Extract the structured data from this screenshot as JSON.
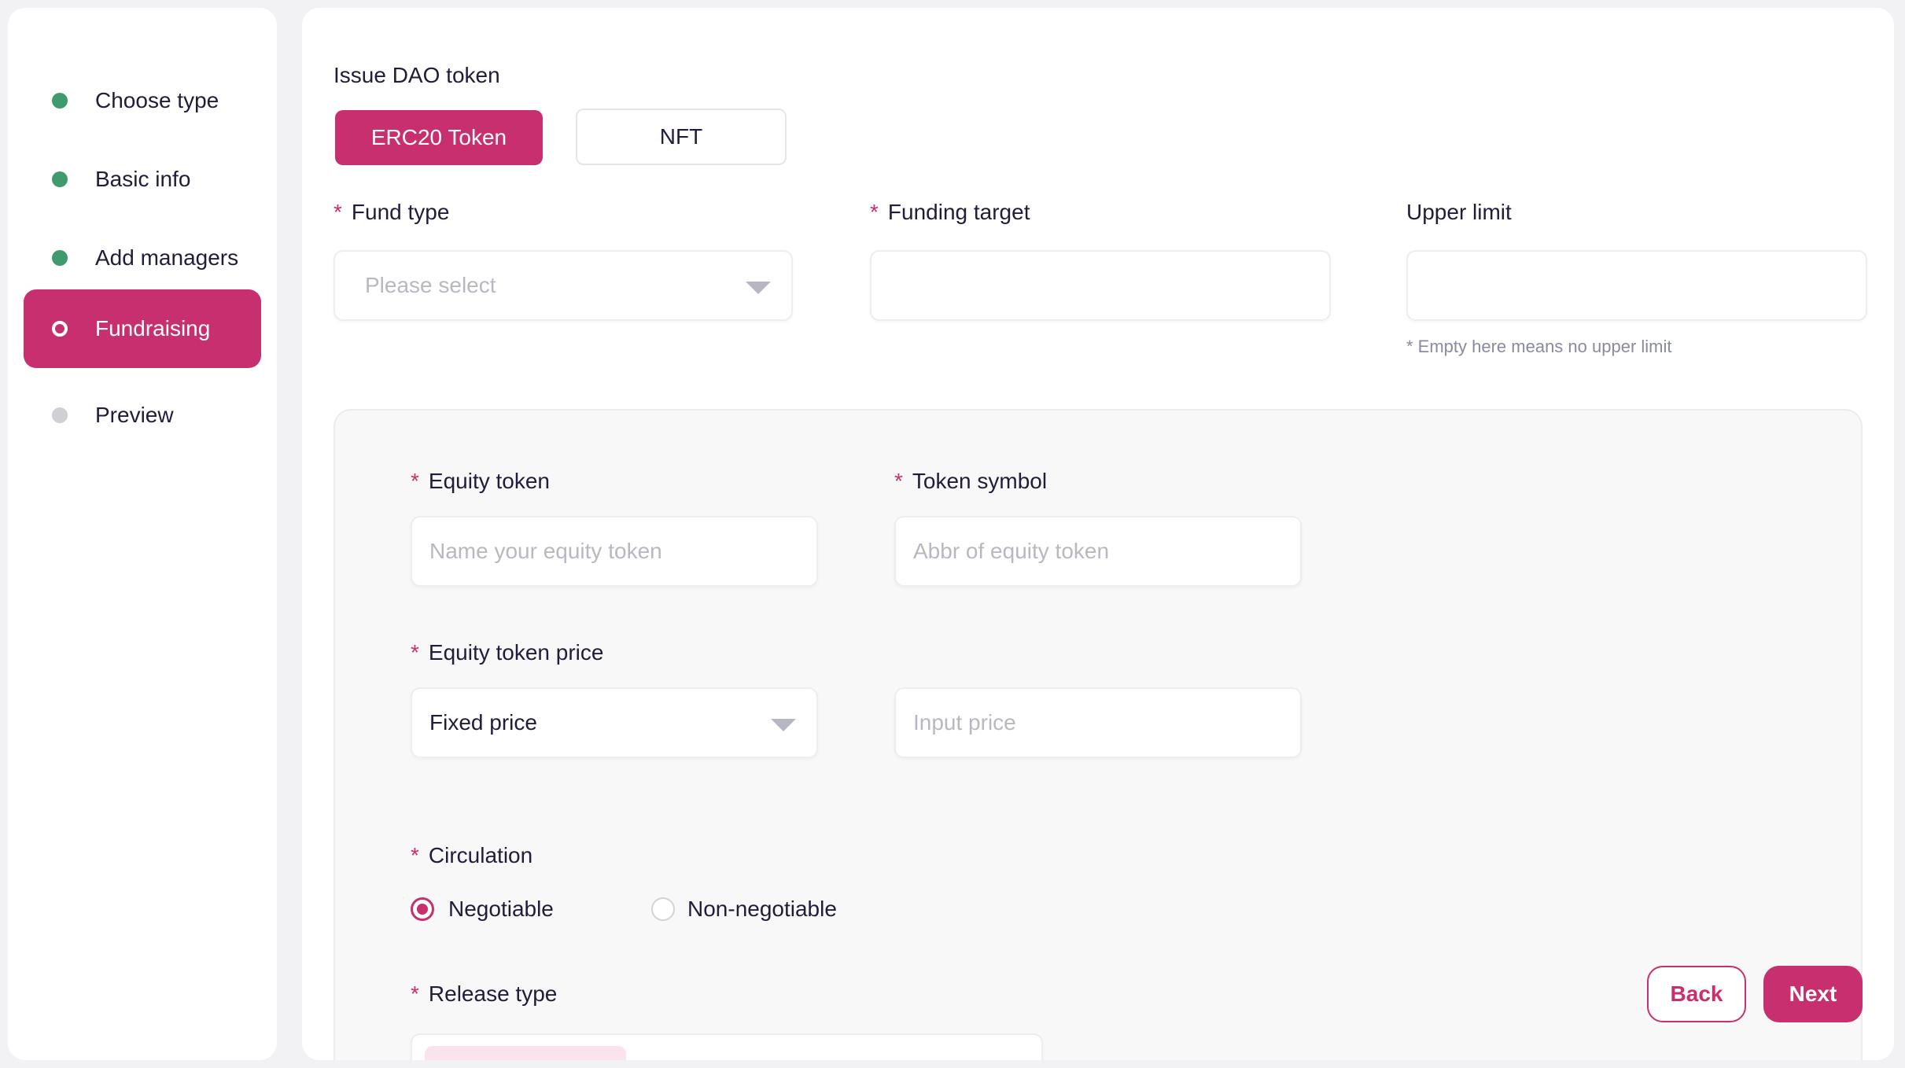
{
  "sidebar": {
    "steps": [
      {
        "label": "Choose type",
        "status": "done"
      },
      {
        "label": "Basic info",
        "status": "done"
      },
      {
        "label": "Add managers",
        "status": "done"
      },
      {
        "label": "Fundraising",
        "status": "active"
      },
      {
        "label": "Preview",
        "status": "pending"
      }
    ]
  },
  "form": {
    "issue_title": "Issue DAO token",
    "token_tabs": [
      {
        "label": "ERC20 Token",
        "selected": true
      },
      {
        "label": "NFT",
        "selected": false
      }
    ],
    "required_mark": "*",
    "fund_type": {
      "label": "Fund type",
      "placeholder": "Please select",
      "icon": "chevron-down-icon"
    },
    "funding_target": {
      "label": "Funding target",
      "value": ""
    },
    "upper_limit": {
      "label": "Upper limit",
      "value": "",
      "hint": "* Empty here means no upper limit"
    },
    "equity_token": {
      "label": "Equity token",
      "placeholder": "Name your equity token"
    },
    "token_symbol": {
      "label": "Token symbol",
      "placeholder": "Abbr of equity token"
    },
    "equity_token_price": {
      "label": "Equity token price",
      "mode": "Fixed price",
      "price_placeholder": "Input price"
    },
    "circulation": {
      "label": "Circulation",
      "options": [
        {
          "label": "Negotiable",
          "checked": true
        },
        {
          "label": "Non-negotiable",
          "checked": false
        }
      ]
    },
    "release_type": {
      "label": "Release type"
    }
  },
  "actions": {
    "back": "Back",
    "next": "Next"
  },
  "colors": {
    "accent": "#c82f6e",
    "done": "#3f9a6d",
    "pending": "#cfcfd4"
  }
}
